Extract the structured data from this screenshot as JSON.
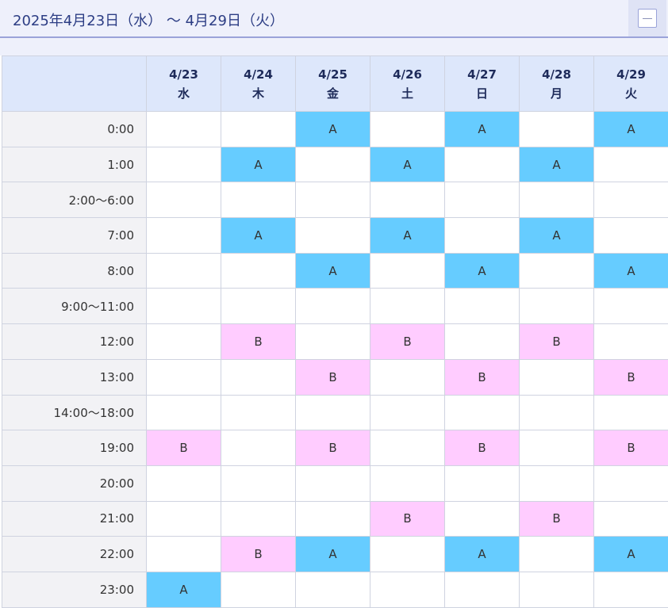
{
  "header": {
    "title": "2025年4月23日（水） ～ 4月29日（火）",
    "collapse_icon": "minus-icon"
  },
  "colors": {
    "slot_A": "#66ccff",
    "slot_B": "#ffccff",
    "header_bg": "#dde7fb",
    "time_col_bg": "#f2f2f5",
    "title_text": "#2c3d84"
  },
  "days": [
    {
      "date": "4/23",
      "weekday": "水"
    },
    {
      "date": "4/24",
      "weekday": "木"
    },
    {
      "date": "4/25",
      "weekday": "金"
    },
    {
      "date": "4/26",
      "weekday": "土"
    },
    {
      "date": "4/27",
      "weekday": "日"
    },
    {
      "date": "4/28",
      "weekday": "月"
    },
    {
      "date": "4/29",
      "weekday": "火"
    }
  ],
  "rows": [
    {
      "time": "0:00",
      "cells": [
        "",
        "",
        "A",
        "",
        "A",
        "",
        "A"
      ]
    },
    {
      "time": "1:00",
      "cells": [
        "",
        "A",
        "",
        "A",
        "",
        "A",
        ""
      ]
    },
    {
      "time": "2:00～6:00",
      "cells": [
        "",
        "",
        "",
        "",
        "",
        "",
        ""
      ]
    },
    {
      "time": "7:00",
      "cells": [
        "",
        "A",
        "",
        "A",
        "",
        "A",
        ""
      ]
    },
    {
      "time": "8:00",
      "cells": [
        "",
        "",
        "A",
        "",
        "A",
        "",
        "A"
      ]
    },
    {
      "time": "9:00～11:00",
      "cells": [
        "",
        "",
        "",
        "",
        "",
        "",
        ""
      ]
    },
    {
      "time": "12:00",
      "cells": [
        "",
        "B",
        "",
        "B",
        "",
        "B",
        ""
      ]
    },
    {
      "time": "13:00",
      "cells": [
        "",
        "",
        "B",
        "",
        "B",
        "",
        "B"
      ]
    },
    {
      "time": "14:00～18:00",
      "cells": [
        "",
        "",
        "",
        "",
        "",
        "",
        ""
      ]
    },
    {
      "time": "19:00",
      "cells": [
        "B",
        "",
        "B",
        "",
        "B",
        "",
        "B"
      ]
    },
    {
      "time": "20:00",
      "cells": [
        "",
        "",
        "",
        "",
        "",
        "",
        ""
      ]
    },
    {
      "time": "21:00",
      "cells": [
        "",
        "",
        "",
        "B",
        "",
        "B",
        ""
      ]
    },
    {
      "time": "22:00",
      "cells": [
        "",
        "B",
        "A",
        "",
        "A",
        "",
        "A"
      ]
    },
    {
      "time": "23:00",
      "cells": [
        "A",
        "",
        "",
        "",
        "",
        "",
        ""
      ]
    }
  ]
}
